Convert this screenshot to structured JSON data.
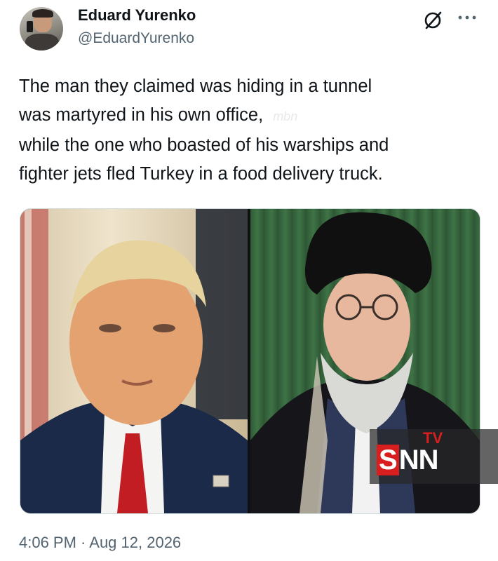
{
  "author": {
    "display_name": "Eduard Yurenko",
    "handle": "@EduardYurenko"
  },
  "tweet": {
    "lines": [
      "The man they claimed was hiding in a tunnel",
      "was martyred in his own office,",
      "while the one who boasted of his warships and",
      "fighter jets fled Turkey in a food delivery truck."
    ],
    "watermark": "mbn",
    "timestamp": "4:06 PM · Aug 12, 2026"
  },
  "media": {
    "left_image": "portrait-man-suit-red-tie",
    "right_image": "portrait-cleric-black-turban",
    "badge": {
      "tv": "TV",
      "s": "S",
      "nn": "NN"
    }
  },
  "icons": {
    "grok": "grok-icon",
    "more": "more-options-icon"
  },
  "colors": {
    "text_primary": "#0f1419",
    "text_secondary": "#536471",
    "badge_red": "#d81e1e"
  }
}
